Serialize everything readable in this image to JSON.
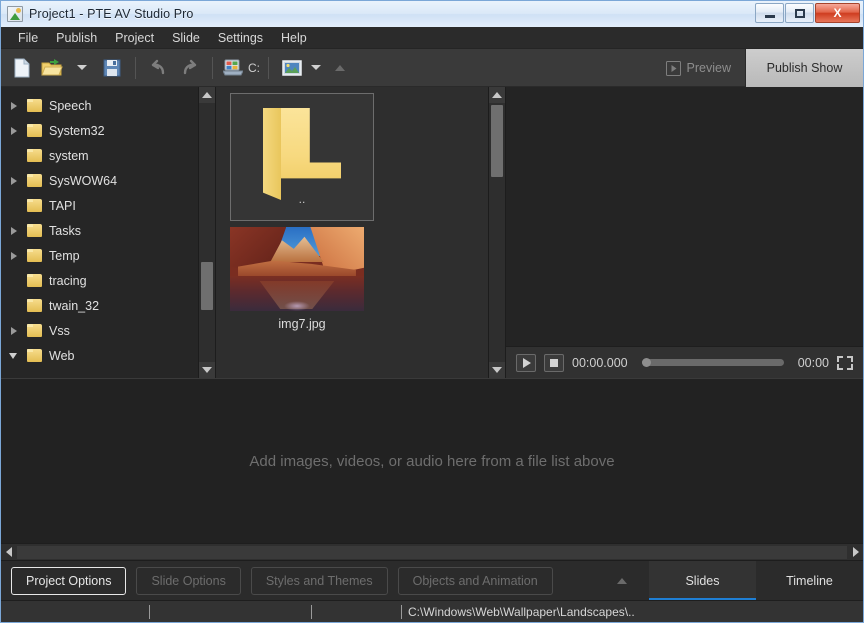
{
  "window": {
    "title": "Project1 - PTE AV Studio Pro",
    "minimize_label": "Minimize",
    "maximize_label": "Maximize",
    "close_label": "X"
  },
  "menubar": {
    "items": [
      {
        "label": "File"
      },
      {
        "label": "Publish"
      },
      {
        "label": "Project"
      },
      {
        "label": "Slide"
      },
      {
        "label": "Settings"
      },
      {
        "label": "Help"
      }
    ]
  },
  "toolbar": {
    "new_label": "New",
    "open_label": "Open",
    "save_label": "Save",
    "undo_label": "Undo",
    "redo_label": "Redo",
    "drive_label": "C:",
    "preview_label": "Preview",
    "publish_label": "Publish Show"
  },
  "tree": {
    "partial_top_item": "",
    "items": [
      {
        "label": "Speech",
        "expandable": true,
        "expanded": false
      },
      {
        "label": "System32",
        "expandable": true,
        "expanded": false
      },
      {
        "label": "system",
        "expandable": false,
        "expanded": false
      },
      {
        "label": "SysWOW64",
        "expandable": true,
        "expanded": false
      },
      {
        "label": "TAPI",
        "expandable": false,
        "expanded": false
      },
      {
        "label": "Tasks",
        "expandable": true,
        "expanded": false
      },
      {
        "label": "Temp",
        "expandable": true,
        "expanded": false
      },
      {
        "label": "tracing",
        "expandable": false,
        "expanded": false
      },
      {
        "label": "twain_32",
        "expandable": false,
        "expanded": false
      },
      {
        "label": "Vss",
        "expandable": true,
        "expanded": false
      },
      {
        "label": "Web",
        "expandable": true,
        "expanded": true
      }
    ]
  },
  "files": {
    "parent_folder_label": "..",
    "items": [
      {
        "name": "img7.jpg",
        "type": "image"
      }
    ]
  },
  "player": {
    "play_label": "Play",
    "stop_label": "Stop",
    "current_time": "00:00.000",
    "total_time": "00:00",
    "fullscreen_label": "Fullscreen",
    "progress_percent": 0
  },
  "slidelist": {
    "placeholder": "Add images, videos, or audio here from a file list above"
  },
  "bottom_buttons": [
    {
      "label": "Project Options",
      "state": "enabled"
    },
    {
      "label": "Slide Options",
      "state": "disabled"
    },
    {
      "label": "Styles and Themes",
      "state": "disabled"
    },
    {
      "label": "Objects and Animation",
      "state": "disabled"
    }
  ],
  "view_tabs": [
    {
      "label": "Slides",
      "active": true
    },
    {
      "label": "Timeline",
      "active": false
    }
  ],
  "statusbar": {
    "cell1": "",
    "cell2": "",
    "cell3": "",
    "path": "C:\\Windows\\Web\\Wallpaper\\Landscapes\\.."
  },
  "colors": {
    "accent_tab": "#1f7fd4",
    "publish_bg": "#c5c5c5",
    "panel_bg": "#2b2b2b",
    "folder_yellow": "#f1d070"
  }
}
